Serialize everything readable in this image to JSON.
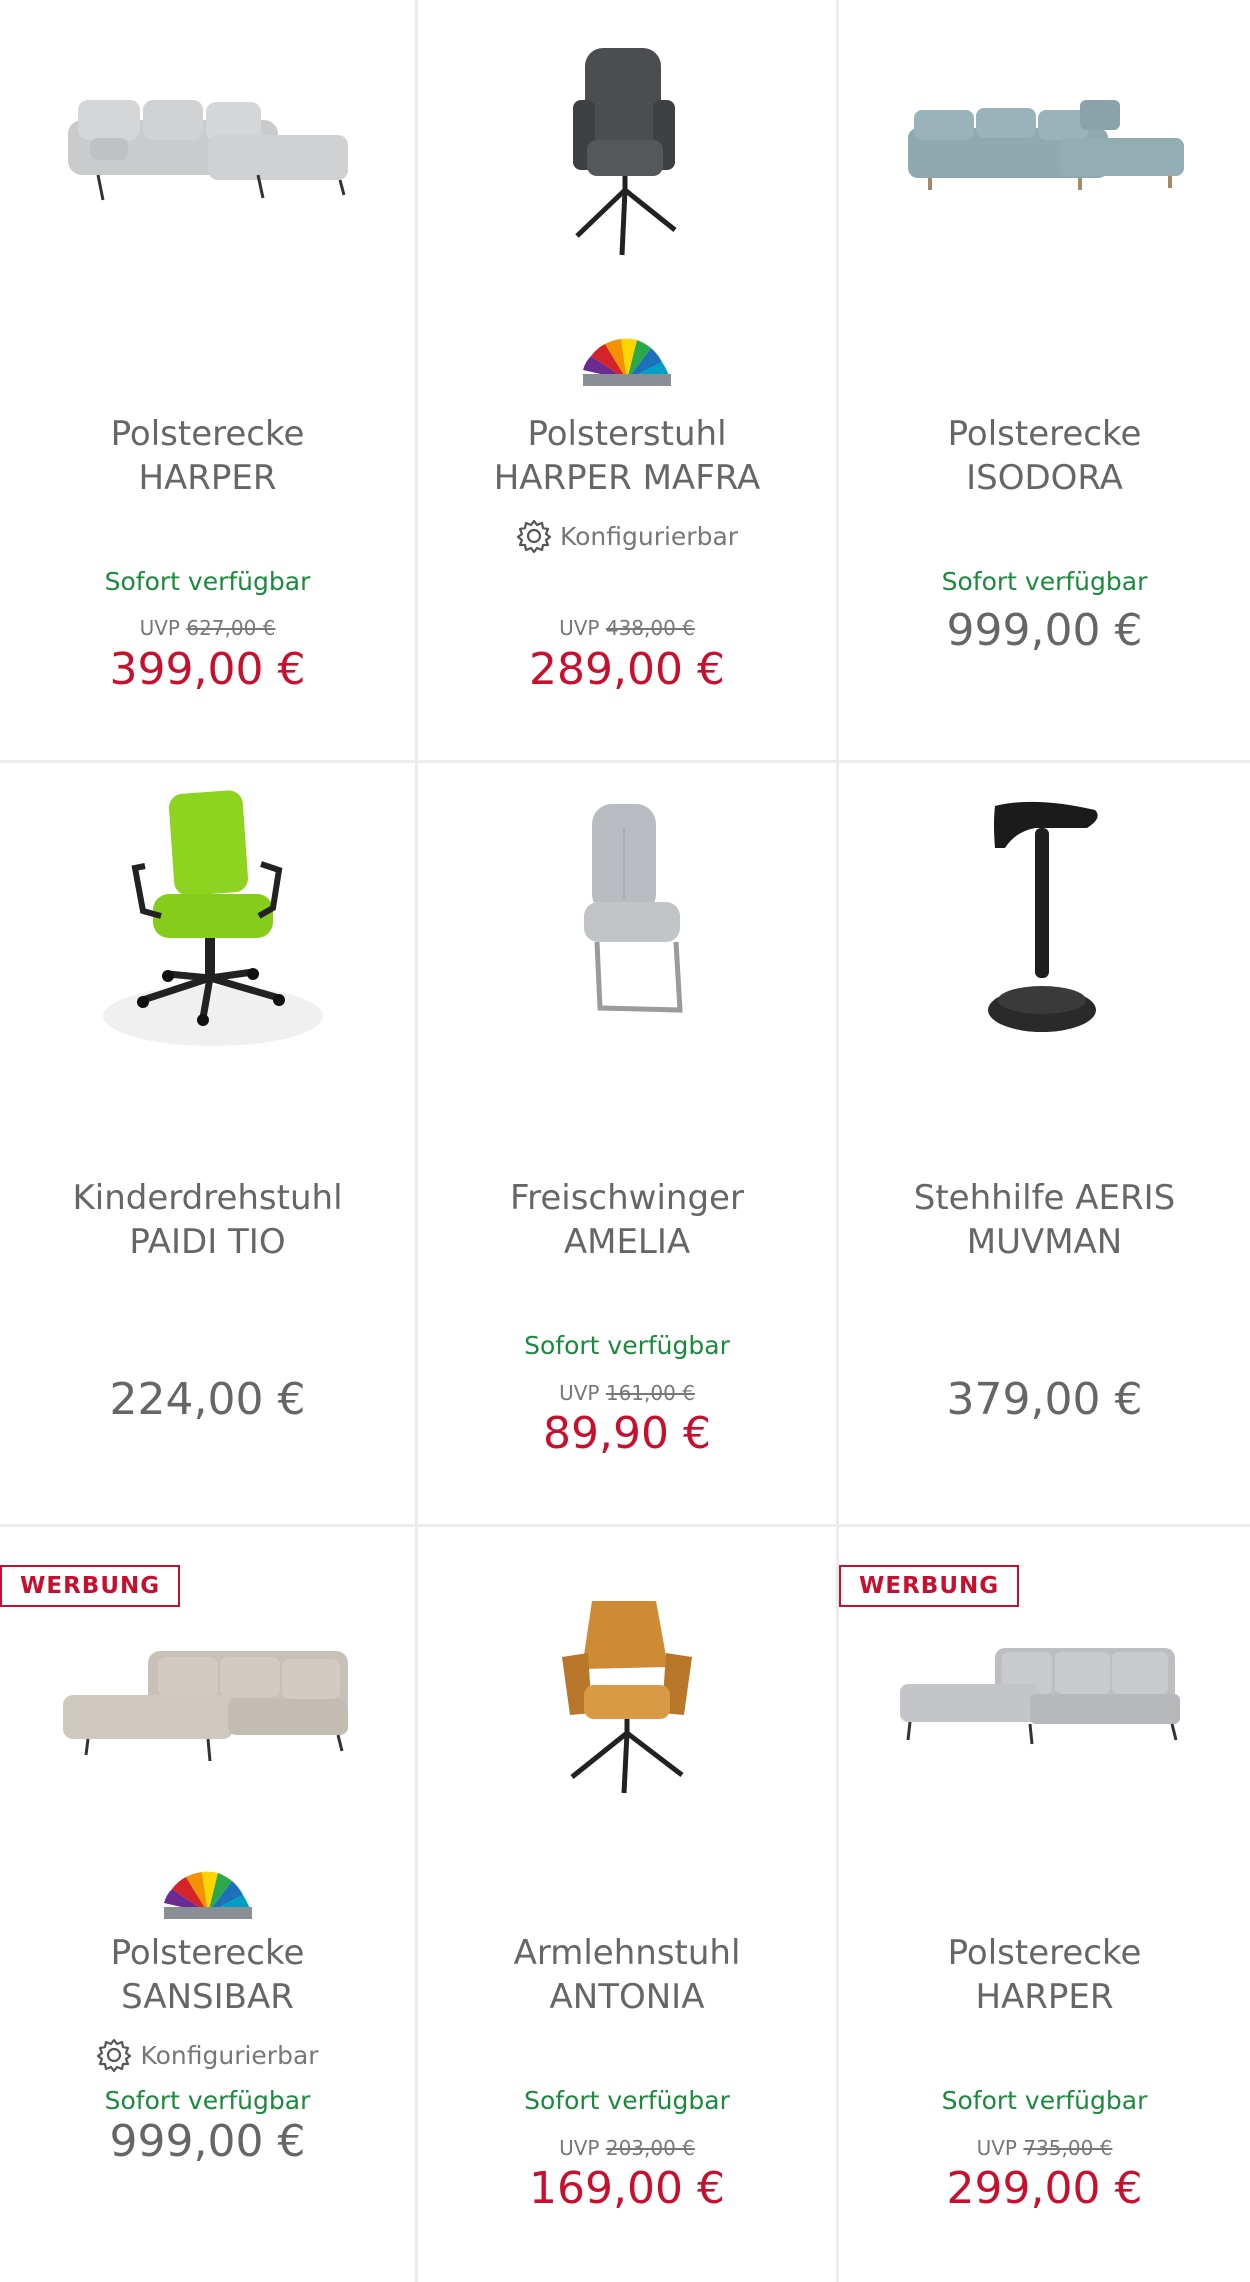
{
  "colors": {
    "sale": "#c8102e",
    "stock": "#1a8a3c",
    "text": "#666666",
    "divider": "#ececec"
  },
  "products": [
    {
      "image": "grey-corner-sofa",
      "title_line1": "Polsterecke",
      "title_line2": "HARPER",
      "stock": "Sofort verfügbar",
      "uvp_label": "UVP",
      "uvp_price": "627,00 €",
      "price": "399,00 €"
    },
    {
      "image": "dark-grey-swivel-chair",
      "color_options_icon": "color-fan-icon",
      "title_line1": "Polsterstuhl",
      "title_line2": "HARPER MAFRA",
      "configurable": "Konfigurierbar",
      "uvp_label": "UVP",
      "uvp_price": "438,00 €",
      "price": "289,00 €"
    },
    {
      "image": "light-blue-corner-sofa",
      "title_line1": "Polsterecke",
      "title_line2": "ISODORA",
      "stock": "Sofort verfügbar",
      "price": "999,00 €"
    },
    {
      "image": "green-office-chair",
      "title_line1": "Kinderdrehstuhl",
      "title_line2": "PAIDI TIO",
      "price": "224,00 €"
    },
    {
      "image": "grey-cantilever-chair",
      "title_line1": "Freischwinger",
      "title_line2": "AMELIA",
      "stock": "Sofort verfügbar",
      "uvp_label": "UVP",
      "uvp_price": "161,00 €",
      "price": "89,90 €"
    },
    {
      "image": "black-standing-stool",
      "title_line1": "Stehhilfe AERIS",
      "title_line2": "MUVMAN",
      "price": "379,00 €"
    },
    {
      "image": "beige-corner-sofa",
      "badge": "WERBUNG",
      "color_options_icon": "color-fan-icon",
      "title_line1": "Polsterecke",
      "title_line2": "SANSIBAR",
      "configurable": "Konfigurierbar",
      "stock": "Sofort verfügbar",
      "price": "999,00 €"
    },
    {
      "image": "orange-armchair",
      "title_line1": "Armlehnstuhl",
      "title_line2": "ANTONIA",
      "stock": "Sofort verfügbar",
      "uvp_label": "UVP",
      "uvp_price": "203,00 €",
      "price": "169,00 €"
    },
    {
      "image": "light-grey-corner-sofa",
      "badge": "WERBUNG",
      "title_line1": "Polsterecke",
      "title_line2": "HARPER",
      "stock": "Sofort verfügbar",
      "uvp_label": "UVP",
      "uvp_price": "735,00 €",
      "price": "299,00 €"
    }
  ]
}
